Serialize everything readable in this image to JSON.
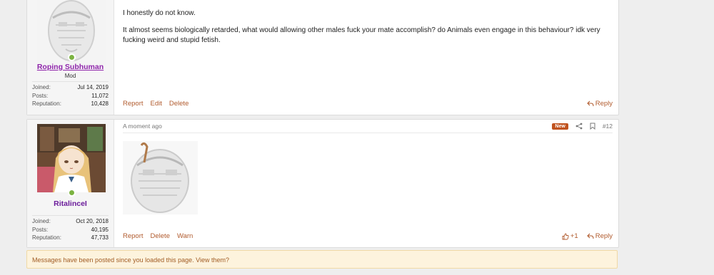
{
  "post1": {
    "username": "Roping Subhuman",
    "user_title": "Mod",
    "stats": [
      {
        "label": "Joined:",
        "value": "Jul 14, 2019"
      },
      {
        "label": "Posts:",
        "value": "11,072"
      },
      {
        "label": "Reputation:",
        "value": "10,428"
      }
    ],
    "paragraphs": [
      "I honestly do not know.",
      "It almost seems biologically retarded, what would allowing other males fuck your mate accomplish? do Animals even engage in this behaviour? idk very fucking weird and stupid fetish."
    ],
    "actions": [
      "Report",
      "Edit",
      "Delete"
    ],
    "reply_label": "Reply"
  },
  "post2": {
    "username": "RitalinceI",
    "stats": [
      {
        "label": "Joined:",
        "value": "Oct 20, 2018"
      },
      {
        "label": "Posts:",
        "value": "40,195"
      },
      {
        "label": "Reputation:",
        "value": "47,733"
      }
    ],
    "timestamp": "A moment ago",
    "new_badge": "New",
    "post_number": "#12",
    "actions": [
      "Report",
      "Delete",
      "Warn"
    ],
    "like_count": "+1",
    "reply_label": "Reply"
  },
  "notice": {
    "text": "Messages have been posted since you loaded this page. View them?"
  }
}
